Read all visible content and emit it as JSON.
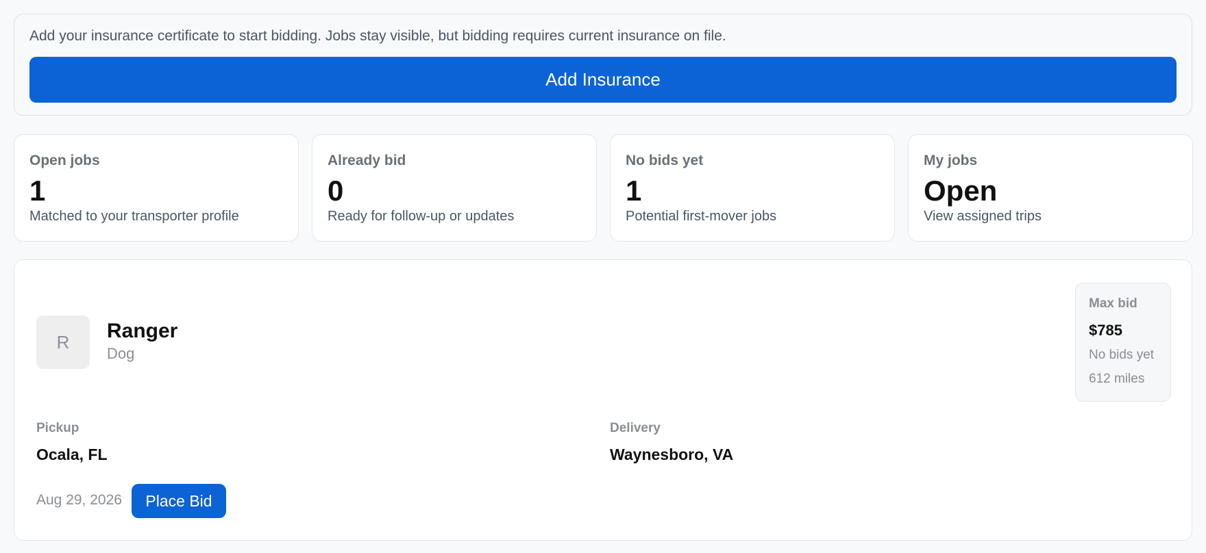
{
  "banner": {
    "message": "Add your insurance certificate to start bidding. Jobs stay visible, but bidding requires current insurance on file.",
    "button_label": "Add Insurance",
    "accent_color": "#0b63d6"
  },
  "stats": [
    {
      "label": "Open jobs",
      "value": "1",
      "sub": "Matched to your transporter profile"
    },
    {
      "label": "Already bid",
      "value": "0",
      "sub": "Ready for follow-up or updates"
    },
    {
      "label": "No bids yet",
      "value": "1",
      "sub": "Potential first-mover jobs"
    },
    {
      "label": "My jobs",
      "value": "Open",
      "sub": "View assigned trips"
    }
  ],
  "job": {
    "avatar_initial": "R",
    "pet_name": "Ranger",
    "pet_type": "Dog",
    "max_bid": {
      "label": "Max bid",
      "value": "$785",
      "status": "No bids yet",
      "distance": "612 miles"
    },
    "pickup": {
      "label": "Pickup",
      "value": "Ocala, FL"
    },
    "delivery": {
      "label": "Delivery",
      "value": "Waynesboro, VA"
    },
    "date": "Aug 29, 2026",
    "bid_button_label": "Place Bid"
  }
}
